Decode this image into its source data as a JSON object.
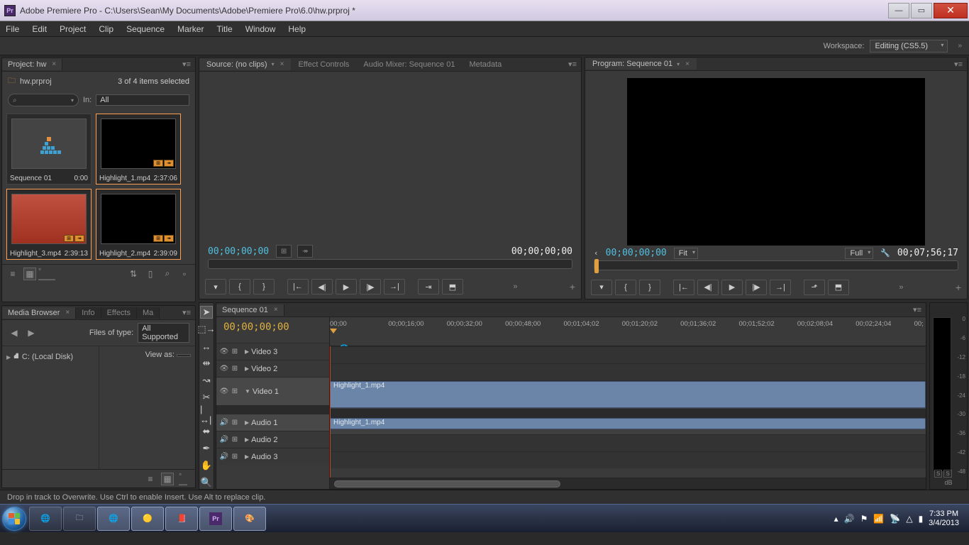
{
  "title": "Adobe Premiere Pro - C:\\Users\\Sean\\My Documents\\Adobe\\Premiere Pro\\6.0\\hw.prproj *",
  "menus": [
    "File",
    "Edit",
    "Project",
    "Clip",
    "Sequence",
    "Marker",
    "Title",
    "Window",
    "Help"
  ],
  "workspace": {
    "label": "Workspace:",
    "value": "Editing (CS5.5)"
  },
  "project": {
    "tab": "Project: hw",
    "file": "hw.prproj",
    "selection": "3 of 4 items selected",
    "search_placeholder": "⌕",
    "in_label": "In:",
    "in_value": "All",
    "bins": [
      {
        "name": "Sequence 01",
        "dur": "0:00",
        "type": "seq"
      },
      {
        "name": "Highlight_1.mp4",
        "dur": "2:37:06",
        "type": "vid"
      },
      {
        "name": "Highlight_3.mp4",
        "dur": "2:39:13",
        "type": "vid",
        "red": true
      },
      {
        "name": "Highlight_2.mp4",
        "dur": "2:39:09",
        "type": "vid"
      }
    ]
  },
  "media": {
    "tabs": [
      "Media Browser",
      "Info",
      "Effects",
      "Ma"
    ],
    "files_label": "Files of type:",
    "files_value": "All Supported",
    "view_label": "View as:",
    "drives": [
      "C: (Local Disk)"
    ]
  },
  "source": {
    "tabs": [
      {
        "label": "Source: (no clips)",
        "active": true,
        "dd": true
      },
      {
        "label": "Effect Controls",
        "active": false
      },
      {
        "label": "Audio Mixer: Sequence 01",
        "active": false
      },
      {
        "label": "Metadata",
        "active": false
      }
    ],
    "tc_left": "00;00;00;00",
    "tc_right": "00;00;00;00"
  },
  "program": {
    "tab": "Program: Sequence 01",
    "tc_left": "00;00;00;00",
    "fit": "Fit",
    "full": "Full",
    "tc_right": "00;07;56;17"
  },
  "timeline": {
    "tab": "Sequence 01",
    "tc": "00;00;00;00",
    "ruler": [
      "00;00",
      "00;00;16;00",
      "00;00;32;00",
      "00;00;48;00",
      "00;01;04;02",
      "00;01;20;02",
      "00;01;36;02",
      "00;01;52;02",
      "00;02;08;04",
      "00;02;24;04",
      "00;"
    ],
    "tracks": {
      "v3": "Video 3",
      "v2": "Video 2",
      "v1": "Video 1",
      "a1": "Audio 1",
      "a2": "Audio 2",
      "a3": "Audio 3"
    },
    "clip_v1": "Highlight_1.mp4",
    "clip_a1": "Highlight_1.mp4"
  },
  "meters": {
    "scale": [
      "0",
      "-6",
      "-12",
      "-18",
      "-24",
      "-30",
      "-36",
      "-42",
      "-48"
    ],
    "unit": "dB"
  },
  "status": "Drop in track to Overwrite. Use Ctrl to enable Insert. Use Alt to replace clip.",
  "tray": {
    "time": "7:33 PM",
    "date": "3/4/2013"
  }
}
